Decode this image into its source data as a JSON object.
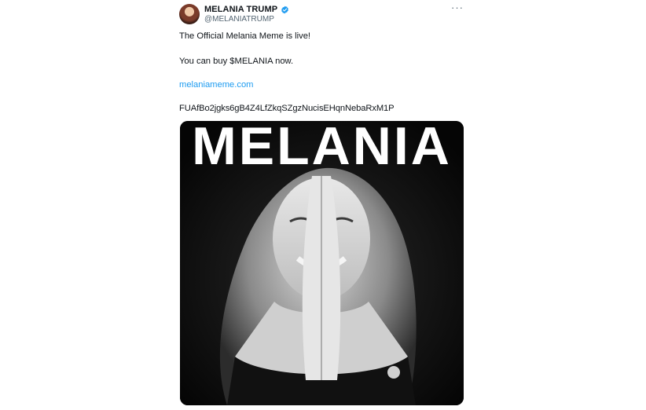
{
  "author": {
    "name": "MELANIA TRUMP",
    "handle": "@MELANIATRUMP",
    "verified": true,
    "avatar_icon": "avatar-photo"
  },
  "menu": {
    "more_label": "···",
    "icon": "more-horizontal-icon"
  },
  "body": {
    "line1": "The Official Melania Meme is live!",
    "line2": "You can buy $MELANIA now.",
    "link": "melaniameme.com",
    "address": "FUAfBo2jgks6gB4Z4LfZkqSZgzNucisEHqnNebaRxM1P"
  },
  "media": {
    "title": "MELANIA",
    "photo_icon": "portrait-photo"
  },
  "colors": {
    "text": "#0f1419",
    "secondary": "#536471",
    "link": "#1d9bf0",
    "verified": "#1d9bf0",
    "media_bg": "#0b0b0b"
  }
}
